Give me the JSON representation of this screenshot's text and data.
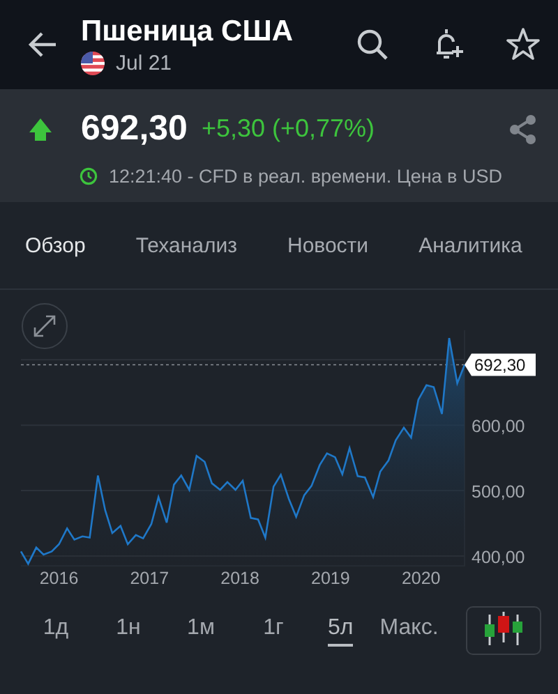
{
  "header": {
    "title": "Пшеница США",
    "subtitle": "Jul 21"
  },
  "quote": {
    "price": "692,30",
    "change": "+5,30 (+0,77%)",
    "rising": true,
    "info": "12:21:40 - CFD в реал. времени. Цена в USD"
  },
  "tabs": [
    {
      "label": "Обзор",
      "selected": true
    },
    {
      "label": "Теханализ",
      "selected": false
    },
    {
      "label": "Новости",
      "selected": false
    },
    {
      "label": "Аналитика",
      "selected": false
    }
  ],
  "chart": {
    "chart_data": {
      "type": "area",
      "grid": true,
      "x": [
        2015.58,
        2015.66,
        2015.75,
        2015.83,
        2015.92,
        2016.0,
        2016.09,
        2016.17,
        2016.26,
        2016.34,
        2016.43,
        2016.51,
        2016.59,
        2016.68,
        2016.76,
        2016.85,
        2016.93,
        2017.02,
        2017.1,
        2017.19,
        2017.27,
        2017.35,
        2017.44,
        2017.52,
        2017.61,
        2017.69,
        2017.78,
        2017.86,
        2017.95,
        2018.03,
        2018.12,
        2018.2,
        2018.28,
        2018.37,
        2018.45,
        2018.54,
        2018.62,
        2018.71,
        2018.79,
        2018.88,
        2018.96,
        2019.05,
        2019.13,
        2019.21,
        2019.3,
        2019.38,
        2019.47,
        2019.55,
        2019.64,
        2019.72,
        2019.81,
        2019.89,
        2019.97,
        2020.06,
        2020.14,
        2020.23,
        2020.31,
        2020.4,
        2020.48
      ],
      "xlim": [
        2015.58,
        2020.48
      ],
      "ylim": [
        385,
        745
      ],
      "xticks": [
        2016,
        2017,
        2018,
        2019,
        2020
      ],
      "yticks": [
        {
          "value": 400,
          "label": "400,00"
        },
        {
          "value": 500,
          "label": "500,00"
        },
        {
          "value": 600,
          "label": "600,00"
        }
      ],
      "ref_lines": [
        {
          "axis": "y",
          "value": 692.3,
          "label": "692,30",
          "color": "#8a8f96"
        }
      ],
      "series": [
        {
          "color": "#1f78c8",
          "values": [
            407,
            388,
            413,
            402,
            407,
            418,
            442,
            425,
            430,
            428,
            523,
            470,
            435,
            446,
            418,
            432,
            427,
            449,
            490,
            451,
            509,
            523,
            501,
            553,
            544,
            511,
            501,
            513,
            501,
            515,
            458,
            456,
            428,
            506,
            524,
            487,
            460,
            493,
            507,
            539,
            557,
            551,
            525,
            565,
            522,
            520,
            490,
            529,
            546,
            577,
            596,
            581,
            639,
            661,
            658,
            617,
            733,
            664,
            692
          ]
        }
      ]
    }
  },
  "ranges": [
    {
      "label": "1д",
      "selected": false
    },
    {
      "label": "1н",
      "selected": false
    },
    {
      "label": "1м",
      "selected": false
    },
    {
      "label": "1г",
      "selected": false
    },
    {
      "label": "5л",
      "selected": true
    },
    {
      "label": "Макс.",
      "selected": false
    }
  ]
}
